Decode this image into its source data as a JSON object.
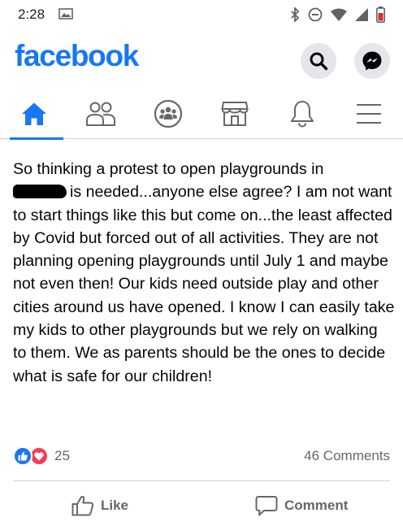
{
  "status_bar": {
    "time": "2:28",
    "icons": [
      "photo-icon",
      "bluetooth-icon",
      "do-not-disturb-icon",
      "wifi-icon",
      "cell-signal-icon",
      "battery-icon"
    ]
  },
  "header": {
    "logo": "facebook",
    "brand_color": "#1877f2",
    "buttons": [
      "search-icon",
      "messenger-icon"
    ]
  },
  "tabs": [
    {
      "name": "home",
      "icon": "home-icon",
      "active": true
    },
    {
      "name": "friends",
      "icon": "friends-icon",
      "active": false
    },
    {
      "name": "groups",
      "icon": "groups-icon",
      "active": false
    },
    {
      "name": "marketplace",
      "icon": "marketplace-icon",
      "active": false
    },
    {
      "name": "notifications",
      "icon": "bell-icon",
      "active": false
    },
    {
      "name": "menu",
      "icon": "menu-icon",
      "active": false
    }
  ],
  "post": {
    "text_part1": "So thinking a protest to open playgrounds in",
    "text_part2": "is needed...anyone else agree?  I am not want to start things like this but come on...the least affected by Covid but forced out of all activities.  They are not planning opening playgrounds until July 1 and maybe not even then!  Our kids need outside play and other cities around us have opened.  I know I can easily take my kids to other playgrounds but we rely on walking to them.  We as parents should be the ones to decide what is safe for our children!"
  },
  "reactions": {
    "types": [
      "like",
      "love"
    ],
    "count": "25",
    "comments": "46 Comments"
  },
  "actions": {
    "like": "Like",
    "comment": "Comment"
  }
}
